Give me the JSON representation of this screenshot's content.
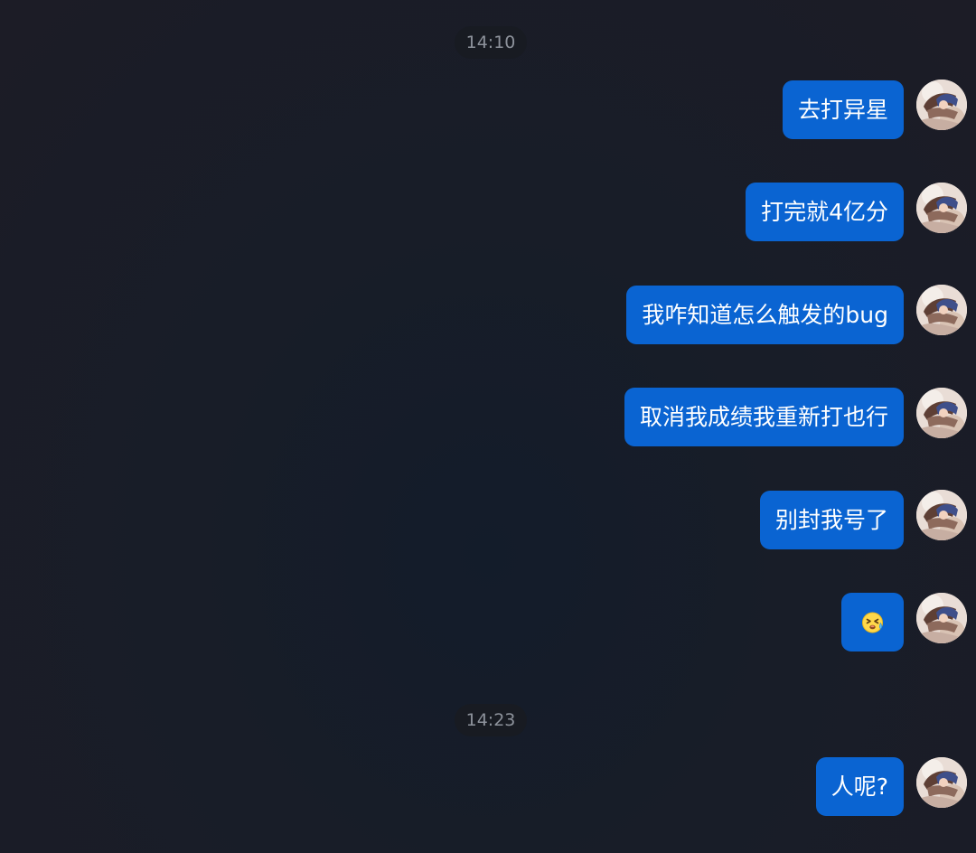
{
  "chat": {
    "timestamps": [
      "14:10",
      "14:23"
    ],
    "messages": [
      {
        "sender": "self",
        "text": "去打异星"
      },
      {
        "sender": "self",
        "text": "打完就4亿分"
      },
      {
        "sender": "self",
        "text": "我咋知道怎么触发的bug"
      },
      {
        "sender": "self",
        "text": "取消我成绩我重新打也行"
      },
      {
        "sender": "self",
        "text": "别封我号了"
      },
      {
        "sender": "self",
        "emoji": "cringe-sweat-emoji-icon"
      },
      {
        "sender": "self",
        "text": "人呢?"
      }
    ]
  },
  "colors": {
    "bubble": "#0a64d2",
    "timestamp_bg": "#181b22",
    "timestamp_text": "#8d929b"
  }
}
